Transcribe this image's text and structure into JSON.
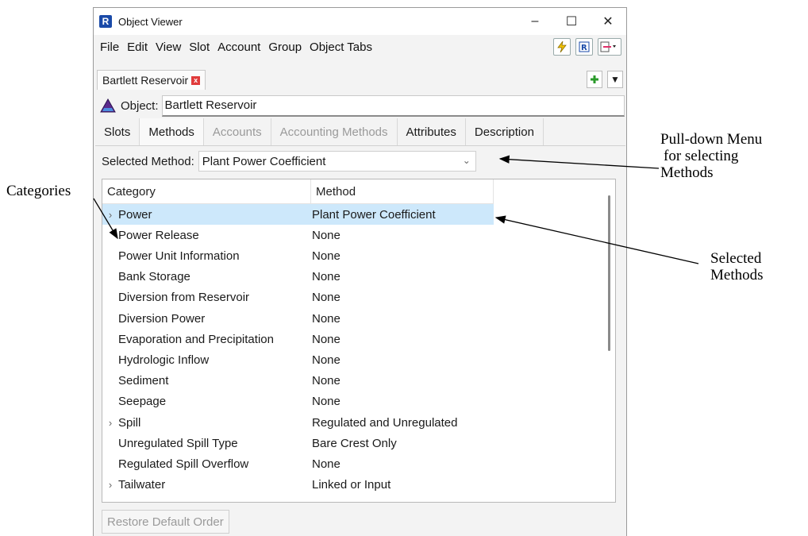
{
  "window": {
    "title": "Object Viewer",
    "controls": {
      "minimize": "–",
      "maximize": "☐",
      "close": "✕"
    }
  },
  "menu": [
    "File",
    "Edit",
    "View",
    "Slot",
    "Account",
    "Group",
    "Object Tabs"
  ],
  "toolbar_icons": [
    "lightning-icon",
    "rw-logo-icon",
    "dispatch-icon"
  ],
  "doc_tab": {
    "label": "Bartlett Reservoir",
    "close": "x"
  },
  "doc_tab_buttons": {
    "add": "+",
    "dropdown": "▼"
  },
  "object": {
    "label": "Object:",
    "value": "Bartlett Reservoir"
  },
  "subtabs": [
    {
      "label": "Slots",
      "state": "normal"
    },
    {
      "label": "Methods",
      "state": "active"
    },
    {
      "label": "Accounts",
      "state": "disabled"
    },
    {
      "label": "Accounting Methods",
      "state": "disabled"
    },
    {
      "label": "Attributes",
      "state": "normal"
    },
    {
      "label": "Description",
      "state": "normal"
    }
  ],
  "selected_method": {
    "label": "Selected Method:",
    "value": "Plant Power Coefficient"
  },
  "table": {
    "headers": [
      "Category",
      "Method"
    ],
    "rows": [
      {
        "category": "Power",
        "method": "Plant Power Coefficient",
        "expandable": true,
        "selected": true
      },
      {
        "category": "Power Release",
        "method": "None",
        "expandable": false
      },
      {
        "category": "Power Unit Information",
        "method": "None",
        "expandable": false
      },
      {
        "category": "Bank Storage",
        "method": "None",
        "expandable": false
      },
      {
        "category": "Diversion from Reservoir",
        "method": "None",
        "expandable": false
      },
      {
        "category": "Diversion Power",
        "method": "None",
        "expandable": false
      },
      {
        "category": "Evaporation and Precipitation",
        "method": "None",
        "expandable": false
      },
      {
        "category": "Hydrologic Inflow",
        "method": "None",
        "expandable": false
      },
      {
        "category": "Sediment",
        "method": "None",
        "expandable": false
      },
      {
        "category": "Seepage",
        "method": "None",
        "expandable": false
      },
      {
        "category": "Spill",
        "method": "Regulated and Unregulated",
        "expandable": true
      },
      {
        "category": "Unregulated Spill Type",
        "method": "Bare Crest Only",
        "expandable": false
      },
      {
        "category": "Regulated Spill Overflow",
        "method": "None",
        "expandable": false
      },
      {
        "category": "Tailwater",
        "method": "Linked or Input",
        "expandable": true
      }
    ]
  },
  "restore_button": "Restore Default Order",
  "annotations": {
    "categories": "Categories",
    "pulldown": [
      "Pull-down Menu",
      "for selecting",
      "Methods"
    ],
    "selected": [
      "Selected",
      "Methods"
    ]
  }
}
